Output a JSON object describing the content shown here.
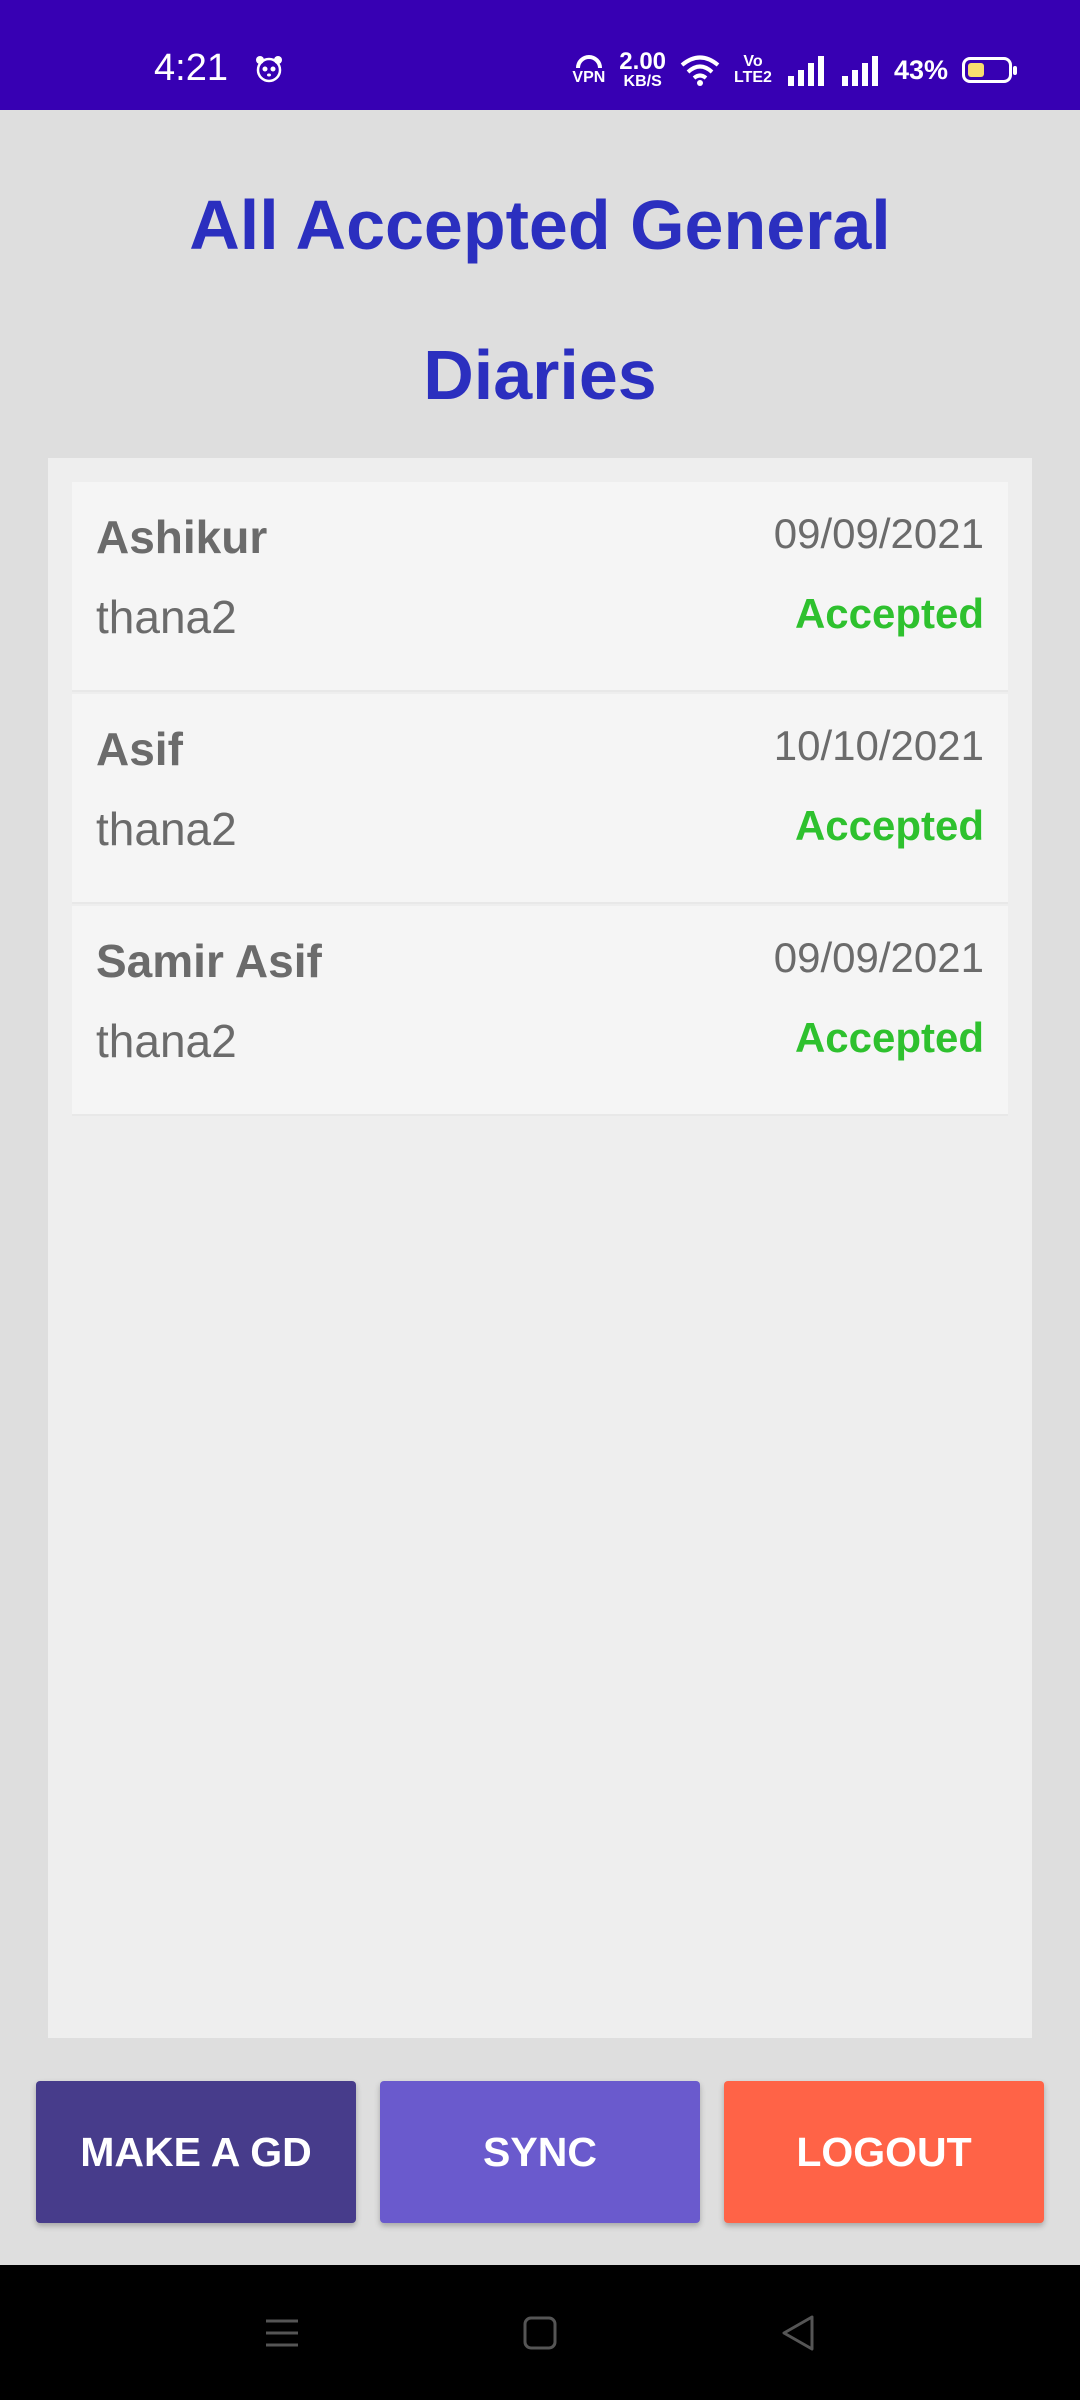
{
  "status_bar": {
    "time": "4:21",
    "vpn_label": "VPN",
    "speed_value": "2.00",
    "speed_unit": "KB/S",
    "volte_label_top": "Vo",
    "volte_label_bottom": "LTE2",
    "battery_percent": "43%",
    "battery_level": 0.43,
    "background_color": "#3700b3"
  },
  "header": {
    "title": "All Accepted General Diaries",
    "title_color": "#2b2fbf"
  },
  "diaries": [
    {
      "name": "Ashikur",
      "station": "thana2",
      "date": "09/09/2021",
      "status": "Accepted"
    },
    {
      "name": "Asif",
      "station": "thana2",
      "date": "10/10/2021",
      "status": "Accepted"
    },
    {
      "name": "Samir Asif",
      "station": "thana2",
      "date": "09/09/2021",
      "status": "Accepted"
    }
  ],
  "status_color": "#2ec12e",
  "actions": {
    "make_gd": {
      "label": "MAKE A GD",
      "color": "#473c8b"
    },
    "sync": {
      "label": "SYNC",
      "color": "#6a5acd"
    },
    "logout": {
      "label": "LOGOUT",
      "color": "#ff6347"
    }
  },
  "nav_bar": {
    "icons": [
      "menu-icon",
      "home-icon",
      "back-icon"
    ]
  }
}
